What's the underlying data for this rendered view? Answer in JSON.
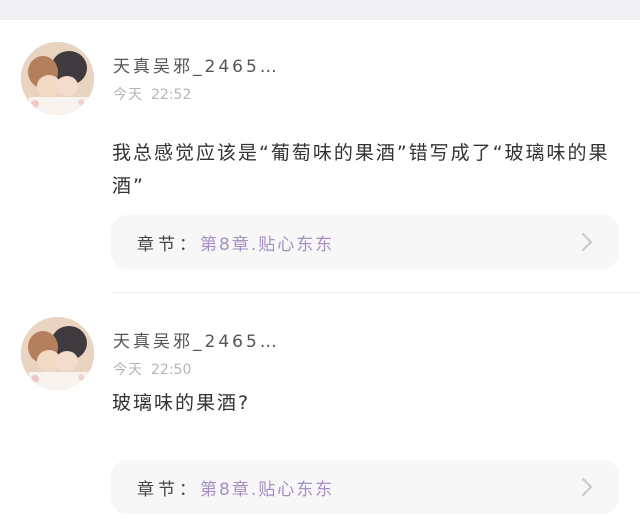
{
  "comments": [
    {
      "username": "天真吴邪_2465…",
      "date_word": "今天",
      "time": "22:52",
      "text": "我总感觉应该是“葡萄味的果酒”错写成了“玻璃味的果酒”",
      "chapter_label": "章节：",
      "chapter_link": "第8章.贴心东东"
    },
    {
      "username": "天真吴邪_2465…",
      "date_word": "今天",
      "time": "22:50",
      "text": "玻璃味的果酒?",
      "chapter_label": "章节：",
      "chapter_link": "第8章.贴心东东"
    }
  ],
  "colors": {
    "chapter_link": "#a58fc4",
    "timestamp": "#b5b5b5",
    "chapter_bar_bg": "#f7f7f8"
  },
  "icons": {
    "avatar": "avatar-image",
    "chevron": "chevron-right-icon"
  }
}
